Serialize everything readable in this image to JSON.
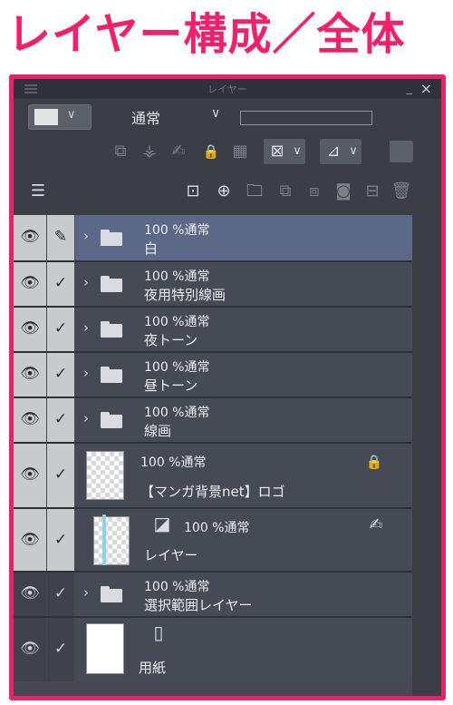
{
  "headline": "レイヤー構成／全体",
  "panel": {
    "title": "レイヤー",
    "minimize": "_",
    "close": "×",
    "blend_mode": "通常",
    "blend_dropdown": "∨",
    "color_dropdown": "∨"
  },
  "layers": [
    {
      "opacity_mode": "100 %通常",
      "name": "白",
      "type": "folder",
      "selected": true,
      "edit_icon": "pencil"
    },
    {
      "opacity_mode": "100 %通常",
      "name": "夜用特別線画",
      "type": "folder"
    },
    {
      "opacity_mode": "100 %通常",
      "name": "夜トーン",
      "type": "folder"
    },
    {
      "opacity_mode": "100 %通常",
      "name": "昼トーン",
      "type": "folder"
    },
    {
      "opacity_mode": "100 %通常",
      "name": "線画",
      "type": "folder"
    },
    {
      "opacity_mode": "100 %通常",
      "name": "【マンガ背景net】ロゴ",
      "type": "raster",
      "locked": true
    },
    {
      "opacity_mode": "100 %通常",
      "name": "レイヤー",
      "type": "raster"
    },
    {
      "opacity_mode": "100 %通常",
      "name": "選択範囲レイヤー",
      "type": "folder",
      "visible_dark": true
    },
    {
      "opacity_mode": "",
      "name": "用紙",
      "type": "paper",
      "visible_dark": true
    }
  ],
  "glyphs": {
    "eye": "👁",
    "check": "✓",
    "pencil": "✎",
    "arrow": "›",
    "lock": "🔒"
  },
  "colors": {
    "accent": "#e8216b",
    "selected_row": "#5b6887",
    "panel_bg": "#454850"
  }
}
